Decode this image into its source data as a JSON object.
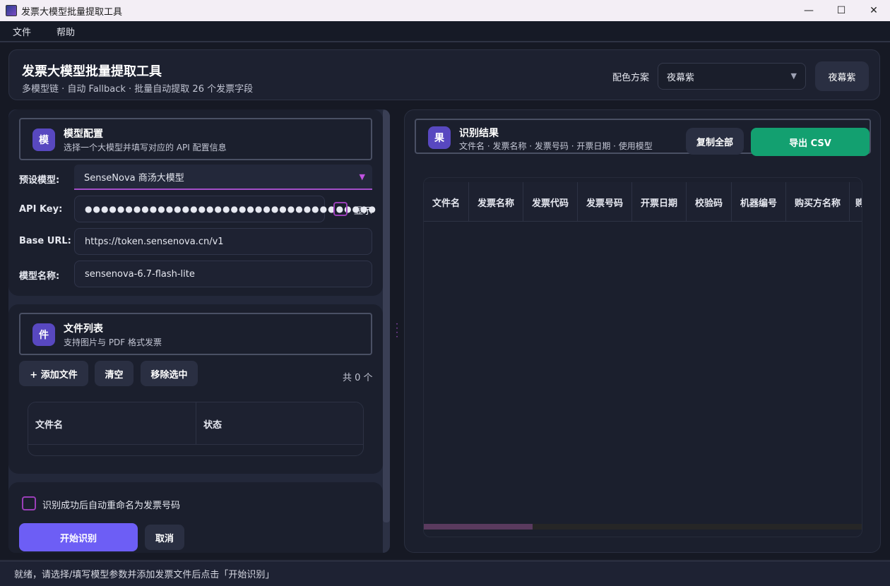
{
  "window": {
    "title": "发票大模型批量提取工具",
    "controls": {
      "minimize": "—",
      "maximize": "☐",
      "close": "✕"
    }
  },
  "menu": {
    "items": [
      "文件",
      "帮助"
    ]
  },
  "header": {
    "title": "发票大模型批量提取工具",
    "subtitle": "多模型链 · 自动 Fallback · 批量自动提取 26 个发票字段",
    "scheme_label": "配色方案",
    "scheme_value": "夜幕紫",
    "scheme_button": "夜幕紫"
  },
  "model_config": {
    "badge": "模",
    "title": "模型配置",
    "subtitle": "选择一个大模型并填写对应的 API 配置信息",
    "preset_label": "预设模型:",
    "preset_value": "SenseNova 商汤大模型",
    "api_key_label": "API Key:",
    "api_key_value": "●●●●●●●●●●●●●●●●●●●●●●●●●●●●●●●●●●●●",
    "show_label": "显示",
    "base_url_label": "Base URL:",
    "base_url_value": "https://token.sensenova.cn/v1",
    "model_name_label": "模型名称:",
    "model_name_value": "sensenova-6.7-flash-lite"
  },
  "file_list": {
    "badge": "件",
    "title": "文件列表",
    "subtitle": "支持图片与 PDF 格式发票",
    "add_button": "+ 添加文件",
    "clear_button": "清空",
    "remove_button": "移除选中",
    "count": "共 0 个",
    "columns": [
      "文件名",
      "状态"
    ]
  },
  "actions": {
    "auto_rename_label": "识别成功后自动重命名为发票号码",
    "start_button": "开始识别",
    "cancel_button": "取消"
  },
  "results": {
    "badge": "果",
    "title": "识别结果",
    "subtitle": "文件名 · 发票名称 · 发票号码 · 开票日期 · 使用模型",
    "copy_button": "复制全部",
    "export_button": "导出 CSV",
    "columns": [
      "文件名",
      "发票名称",
      "发票代码",
      "发票号码",
      "开票日期",
      "校验码",
      "机器编号",
      "购买方名称",
      "购"
    ]
  },
  "status": {
    "text": "就绪，请选择/填写模型参数并添加发票文件后点击「开始识别」"
  },
  "colors": {
    "accent": "#6d5ef5",
    "badge": "#5848c0",
    "export": "#13a070",
    "checkbox": "#9a3fb8"
  }
}
